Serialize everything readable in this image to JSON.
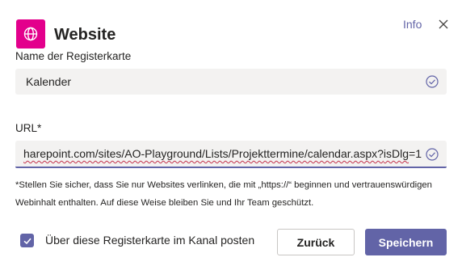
{
  "dialog": {
    "title": "Website",
    "info_label": "Info",
    "icon": "globe-icon",
    "accent_color": "#6264a7",
    "app_icon_color": "#e3008c"
  },
  "tab_name": {
    "label": "Name der Registerkarte",
    "value": "Kalender"
  },
  "url": {
    "label": "URL*",
    "value_parts": [
      "harepoint.com/sites/AO-Playground/Lists/Projekttermine/calendar.aspx?",
      "isDlg",
      "=1"
    ]
  },
  "note": "*Stellen Sie sicher, dass Sie nur Websites verlinken, die mit „https://“ beginnen und vertrauenswürdigen Webinhalt enthalten. Auf diese Weise bleiben Sie und Ihr Team geschützt.",
  "post_option": {
    "label": "Über diese Registerkarte im Kanal posten",
    "checked": true
  },
  "buttons": {
    "back": "Zurück",
    "save": "Speichern"
  }
}
